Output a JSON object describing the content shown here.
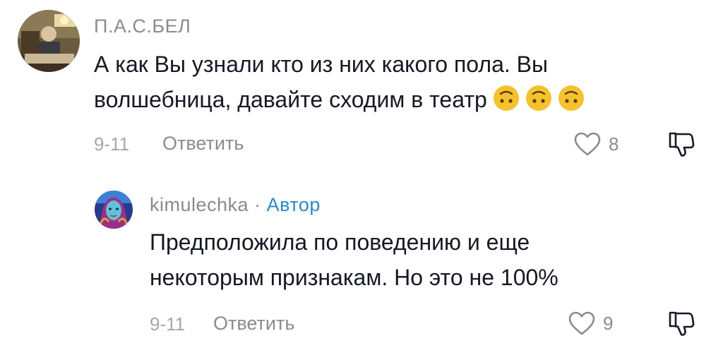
{
  "comments": [
    {
      "username": "П.А.С.БЕЛ",
      "text_line1": "А как Вы узнали кто из них какого пола. Вы",
      "text_line2": "волшебница, давайте сходим в театр",
      "emojis": [
        "upside-down-face",
        "upside-down-face",
        "upside-down-face"
      ],
      "date": "9-11",
      "reply_label": "Ответить",
      "likes": "8"
    },
    {
      "username": "kimulechka",
      "separator": "·",
      "author_badge": "Автор",
      "text_line1": "Предположила по поведению и еще",
      "text_line2": "некоторым признакам. Но это не 100%",
      "date": "9-11",
      "reply_label": "Ответить",
      "likes": "9"
    }
  ],
  "icons": {
    "like": "heart-outline-icon",
    "dislike": "thumbs-down-outline-icon"
  },
  "colors": {
    "text": "#161823",
    "muted": "#8a8b91",
    "author": "#2c89c9",
    "emoji": "#f5c12e"
  }
}
